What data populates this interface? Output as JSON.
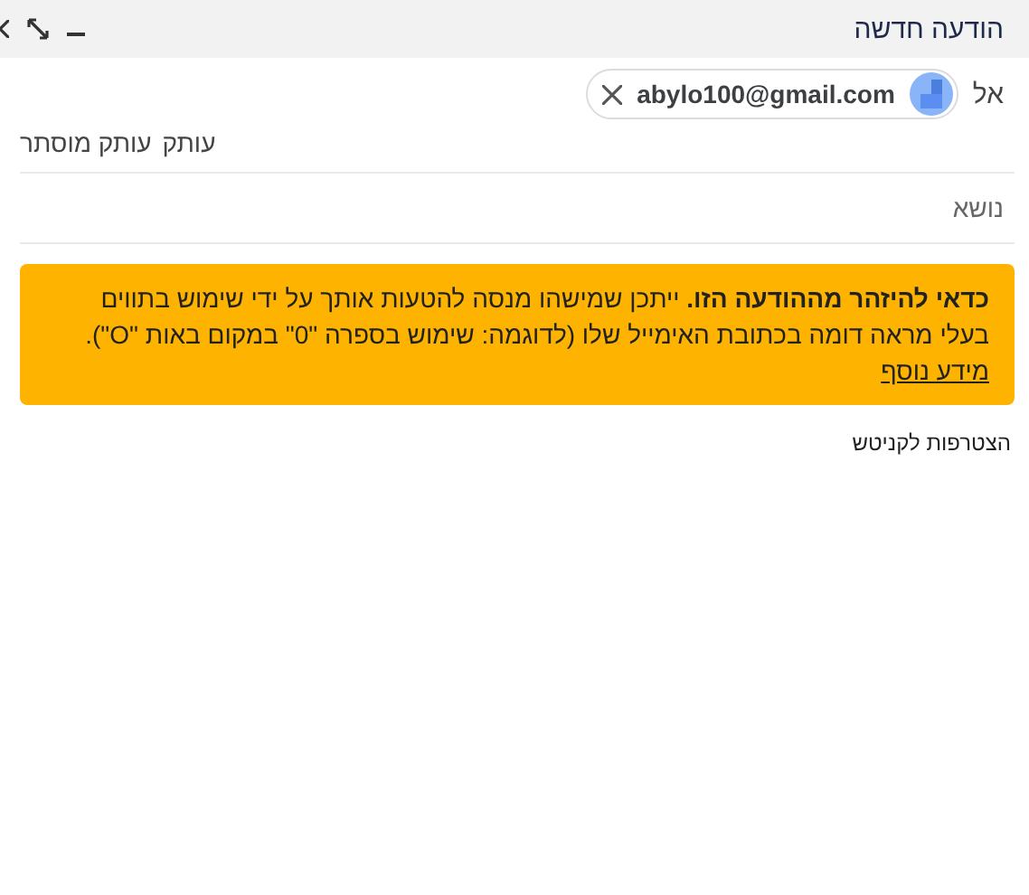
{
  "window": {
    "title": "הודעה חדשה"
  },
  "recipients": {
    "label": "אל",
    "chips": [
      {
        "email": "abylo100@gmail.com"
      }
    ]
  },
  "cc_links": [
    "עותק",
    "עותק מוסתר"
  ],
  "subject": {
    "placeholder": "נושא"
  },
  "warning": {
    "text": "**כדאי להיזהר מההודעה הזו.** ייתכן שמישהו מנסה להטעות אותך על ידי שימוש בתווים בעלי מראה דומה בכתובת האימייל שלו (לדוגמה: שימוש בספרה \"0\" במקום באות \"O\").",
    "link": "מידע נוסף"
  },
  "body": {
    "value": "הצטרפות לקניטש"
  }
}
